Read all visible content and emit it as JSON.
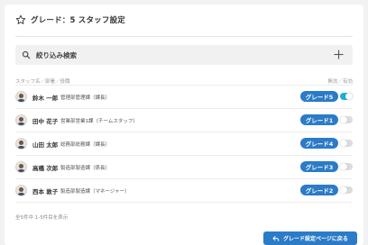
{
  "header": {
    "title": "グレード：5 スタッフ設定",
    "icon": "star-icon"
  },
  "search": {
    "label": "絞り込み検索",
    "icon": "search-icon",
    "add_icon": "plus-icon"
  },
  "table": {
    "col_left": "スタッフ名／部署／役職",
    "col_right": "無効／有効",
    "rows": [
      {
        "name": "鈴木 一郎",
        "dept": "管理部管理課（課長）",
        "grade": "グレード5",
        "enabled": true
      },
      {
        "name": "田中 花子",
        "dept": "営業部営業1課（チームスタッフ）",
        "grade": "グレード1",
        "enabled": false
      },
      {
        "name": "山田 太郎",
        "dept": "総務部総務課（課長）",
        "grade": "グレード4",
        "enabled": false
      },
      {
        "name": "高橋 次郎",
        "dept": "製造部製造課（係長）",
        "grade": "グレード3",
        "enabled": false
      },
      {
        "name": "西本 敦子",
        "dept": "製造部製造課（マネージャー）",
        "grade": "グレード2",
        "enabled": false
      }
    ]
  },
  "footer": {
    "count_text": "全5件中 1-5件目を表示",
    "back_label": "グレード設定ページに戻る",
    "back_icon": "return-arrow-icon"
  },
  "colors": {
    "accent": "#2b7bc7",
    "toggle_on": "#1ab0d8",
    "toggle_off": "#dcdcdc"
  }
}
